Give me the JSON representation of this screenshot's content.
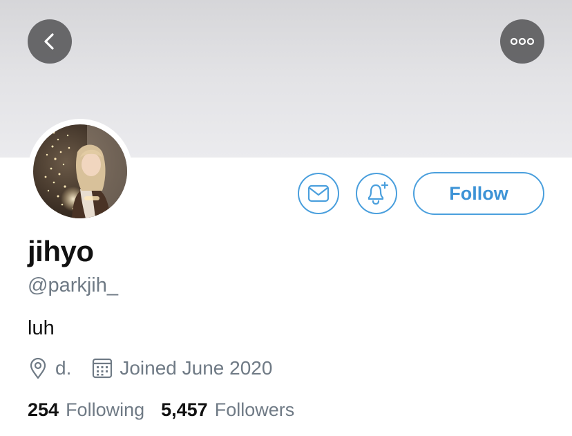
{
  "profile": {
    "display_name": "jihyo",
    "handle": "@parkjih_",
    "bio": "luh",
    "location": "d.",
    "joined": "Joined June 2020"
  },
  "stats": {
    "following_count": "254",
    "following_label": "Following",
    "followers_count": "5,457",
    "followers_label": "Followers"
  },
  "actions": {
    "follow_label": "Follow"
  },
  "icons": {
    "back": "chevron-left-icon",
    "more": "more-horizontal-icon",
    "message": "envelope-icon",
    "notify": "bell-plus-icon",
    "location": "location-pin-icon",
    "calendar": "calendar-icon"
  },
  "colors": {
    "accent": "#4a9fdd",
    "secondary_text": "#6f7a85",
    "primary_text": "#111111",
    "banner": "#e3e3e6"
  }
}
